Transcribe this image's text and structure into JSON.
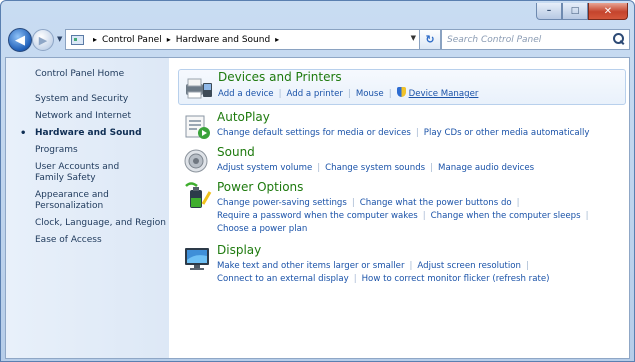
{
  "window": {
    "caption_buttons": {
      "minimize": "–",
      "maximize": "□",
      "close": "✕"
    }
  },
  "navigation": {
    "back_glyph": "◀",
    "forward_glyph": "▶",
    "recent_glyph": "▼",
    "breadcrumb": [
      "Control Panel",
      "Hardware and Sound"
    ],
    "breadcrumb_separator": "▸",
    "address_dropdown_glyph": "▼",
    "refresh_glyph": "↻",
    "search_placeholder": "Search Control Panel"
  },
  "sidebar": {
    "items": [
      {
        "label": "Control Panel Home",
        "active": false
      },
      {
        "label": "System and Security",
        "active": false
      },
      {
        "label": "Network and Internet",
        "active": false
      },
      {
        "label": "Hardware and Sound",
        "active": true
      },
      {
        "label": "Programs",
        "active": false
      },
      {
        "label": "User Accounts and Family Safety",
        "active": false
      },
      {
        "label": "Appearance and Personalization",
        "active": false
      },
      {
        "label": "Clock, Language, and Region",
        "active": false
      },
      {
        "label": "Ease of Access",
        "active": false
      }
    ]
  },
  "categories": {
    "devices": {
      "title": "Devices and Printers",
      "icon": "printer-icon",
      "links": [
        "Add a device",
        "Add a printer",
        "Mouse",
        "Device Manager"
      ]
    },
    "autoplay": {
      "title": "AutoPlay",
      "icon": "autoplay-icon",
      "links": [
        "Change default settings for media or devices",
        "Play CDs or other media automatically"
      ]
    },
    "sound": {
      "title": "Sound",
      "icon": "speaker-icon",
      "links": [
        "Adjust system volume",
        "Change system sounds",
        "Manage audio devices"
      ]
    },
    "power": {
      "title": "Power Options",
      "icon": "power-battery-icon",
      "links": [
        "Change power-saving settings",
        "Change what the power buttons do",
        "Require a password when the computer wakes",
        "Change when the computer sleeps",
        "Choose a power plan"
      ]
    },
    "display": {
      "title": "Display",
      "icon": "monitor-icon",
      "links": [
        "Make text and other items larger or smaller",
        "Adjust screen resolution",
        "Connect to an external display",
        "How to correct monitor flicker (refresh rate)"
      ]
    }
  },
  "colors": {
    "category_title": "#1e7a0e",
    "link": "#1a52a8",
    "sidebar_text": "#1e395b",
    "separator": "#a3b7d1"
  }
}
